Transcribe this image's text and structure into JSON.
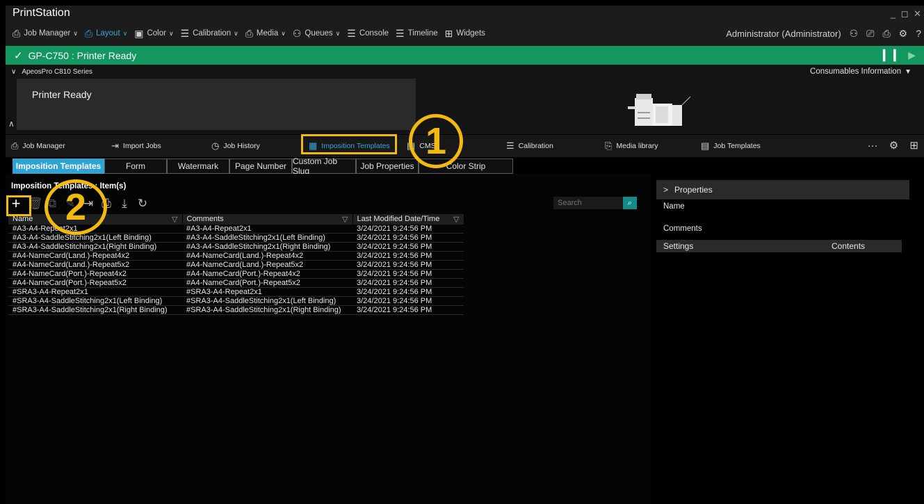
{
  "app": {
    "title": "PrintStation",
    "window_controls": "_ ◻ ✕"
  },
  "menubar": {
    "items": [
      {
        "label": "Job Manager",
        "icon": "printer-icon",
        "glyph": "⎙"
      },
      {
        "label": "Layout",
        "icon": "layout-icon",
        "glyph": "⎙"
      },
      {
        "label": "Color",
        "icon": "color-icon",
        "glyph": "▣"
      },
      {
        "label": "Calibration",
        "icon": "calibration-icon",
        "glyph": "☰"
      },
      {
        "label": "Media",
        "icon": "media-icon",
        "glyph": "⎙"
      },
      {
        "label": "Queues",
        "icon": "queues-icon",
        "glyph": "⚇"
      },
      {
        "label": "Console",
        "icon": "console-icon",
        "glyph": "☰"
      },
      {
        "label": "Timeline",
        "icon": "timeline-icon",
        "glyph": "☰"
      },
      {
        "label": "Widgets",
        "icon": "widgets-icon",
        "glyph": "⊞"
      }
    ],
    "user": "Administrator (Administrator)"
  },
  "status": {
    "printer": "GP-C750 : Printer Ready"
  },
  "printer_panel": {
    "series": "ApeosPro C810 Series",
    "state": "Printer Ready",
    "consumables": "Consumables Information"
  },
  "subnav": {
    "items": [
      {
        "label": "Job Manager",
        "icon": "printer-icon",
        "glyph": "⎙"
      },
      {
        "label": "Import Jobs",
        "icon": "import-icon",
        "glyph": "⇥"
      },
      {
        "label": "Job History",
        "icon": "history-icon",
        "glyph": "◷"
      },
      {
        "label": "Imposition Templates",
        "icon": "imposition-icon",
        "glyph": "▦"
      },
      {
        "label": "CMS",
        "icon": "cms-icon",
        "glyph": "▤"
      },
      {
        "label": "Calibration",
        "icon": "calibration-icon",
        "glyph": "☰"
      },
      {
        "label": "Media library",
        "icon": "media-library-icon",
        "glyph": "⎘"
      },
      {
        "label": "Job Templates",
        "icon": "job-templates-icon",
        "glyph": "▤"
      }
    ]
  },
  "tabs": [
    "Imposition Templates",
    "Form",
    "Watermark",
    "Page Number",
    "Custom Job Slug",
    "Job Properties",
    "Color Strip"
  ],
  "list": {
    "title": "Imposition Templates : ",
    "count_text": "Item(s)",
    "search_placeholder": "Search",
    "columns": [
      "Name",
      "Comments",
      "Last Modified Date/Time"
    ],
    "rows": [
      [
        "#A3-A4-Repeat2x1",
        "#A3-A4-Repeat2x1",
        "3/24/2021 9:24:56 PM"
      ],
      [
        "#A3-A4-SaddleStitching2x1(Left Binding)",
        "#A3-A4-SaddleStitching2x1(Left Binding)",
        "3/24/2021 9:24:56 PM"
      ],
      [
        "#A3-A4-SaddleStitching2x1(Right Binding)",
        "#A3-A4-SaddleStitching2x1(Right Binding)",
        "3/24/2021 9:24:56 PM"
      ],
      [
        "#A4-NameCard(Land.)-Repeat4x2",
        "#A4-NameCard(Land.)-Repeat4x2",
        "3/24/2021 9:24:56 PM"
      ],
      [
        "#A4-NameCard(Land.)-Repeat5x2",
        "#A4-NameCard(Land.)-Repeat5x2",
        "3/24/2021 9:24:56 PM"
      ],
      [
        "#A4-NameCard(Port.)-Repeat4x2",
        "#A4-NameCard(Port.)-Repeat4x2",
        "3/24/2021 9:24:56 PM"
      ],
      [
        "#A4-NameCard(Port.)-Repeat5x2",
        "#A4-NameCard(Port.)-Repeat5x2",
        "3/24/2021 9:24:56 PM"
      ],
      [
        "#SRA3-A4-Repeat2x1",
        "#SRA3-A4-Repeat2x1",
        "3/24/2021 9:24:56 PM"
      ],
      [
        "#SRA3-A4-SaddleStitching2x1(Left Binding)",
        "#SRA3-A4-SaddleStitching2x1(Left Binding)",
        "3/24/2021 9:24:56 PM"
      ],
      [
        "#SRA3-A4-SaddleStitching2x1(Right Binding)",
        "#SRA3-A4-SaddleStitching2x1(Right Binding)",
        "3/24/2021 9:24:56 PM"
      ]
    ]
  },
  "properties": {
    "header": "Properties",
    "name_label": "Name",
    "comments_label": "Comments",
    "settings_col": "Settings",
    "contents_col": "Contents"
  },
  "callouts": {
    "one": "1",
    "two": "2"
  },
  "colors": {
    "accent": "#35a6dd",
    "status_green": "#139660",
    "callout": "#f2b90f",
    "active_tab": "#31a3d3"
  }
}
